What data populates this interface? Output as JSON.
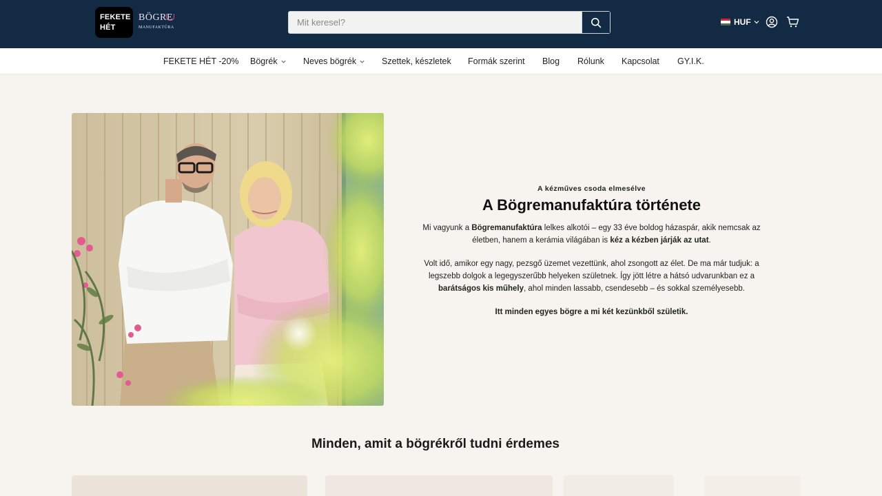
{
  "header": {
    "logo_badge": [
      "FEKETE",
      "HÉT"
    ],
    "logo_word": "BÖGRE",
    "logo_sub": "MANUFAKTÚRA",
    "search_placeholder": "Mit keresel?",
    "search_icon": "search-icon",
    "currency": "HUF",
    "flag_colors": [
      "#ce2939",
      "#ffffff",
      "#477050"
    ],
    "account_icon": "user-circle-icon",
    "cart_icon": "cart-icon"
  },
  "nav": {
    "items": [
      {
        "label": "FEKETE HÉT -20%",
        "has_dropdown": false
      },
      {
        "label": "Bögrék",
        "has_dropdown": true
      },
      {
        "label": "Neves bögrék",
        "has_dropdown": true
      },
      {
        "label": "Szettek, készletek",
        "has_dropdown": false
      },
      {
        "label": "Formák szerint",
        "has_dropdown": false
      },
      {
        "label": "Blog",
        "has_dropdown": false
      },
      {
        "label": "Rólunk",
        "has_dropdown": false
      },
      {
        "label": "Kapcsolat",
        "has_dropdown": false
      },
      {
        "label": "GY.I.K.",
        "has_dropdown": false
      }
    ]
  },
  "story": {
    "eyebrow": "A kézműves csoda elmesélve",
    "title": "A Bögremanufaktúra története",
    "p1": {
      "t1": "Mi vagyunk a ",
      "b1": "Bögremanufaktúra",
      "t2": " lelkes alkotói – egy 33 éve boldog házaspár, akik nemcsak az életben, hanem a kerámia világában is ",
      "b2": "kéz a kézben járják az utat",
      "t3": "."
    },
    "p2": {
      "t1": "Volt idő, amikor egy nagy, pezsgő üzemet vezettünk, ahol zsongott az élet. De ma már tudjuk: a legszebb dolgok a legegyszerűbb helyeken születnek. Így jött létre a hátsó udvarunkban ez a ",
      "b1": "barátságos kis műhely",
      "t2": ", ahol minden lassabb, csendesebb – és sokkal személyesebb."
    },
    "closing": "Itt minden egyes bögre a mi két kezünkből születik."
  },
  "faq_section": {
    "title": "Minden, amit a bögrékről tudni érdemes"
  },
  "colors": {
    "header_bg": "#132a44",
    "page_bg": "#f7f3ee",
    "nav_bg": "#ffffff"
  }
}
